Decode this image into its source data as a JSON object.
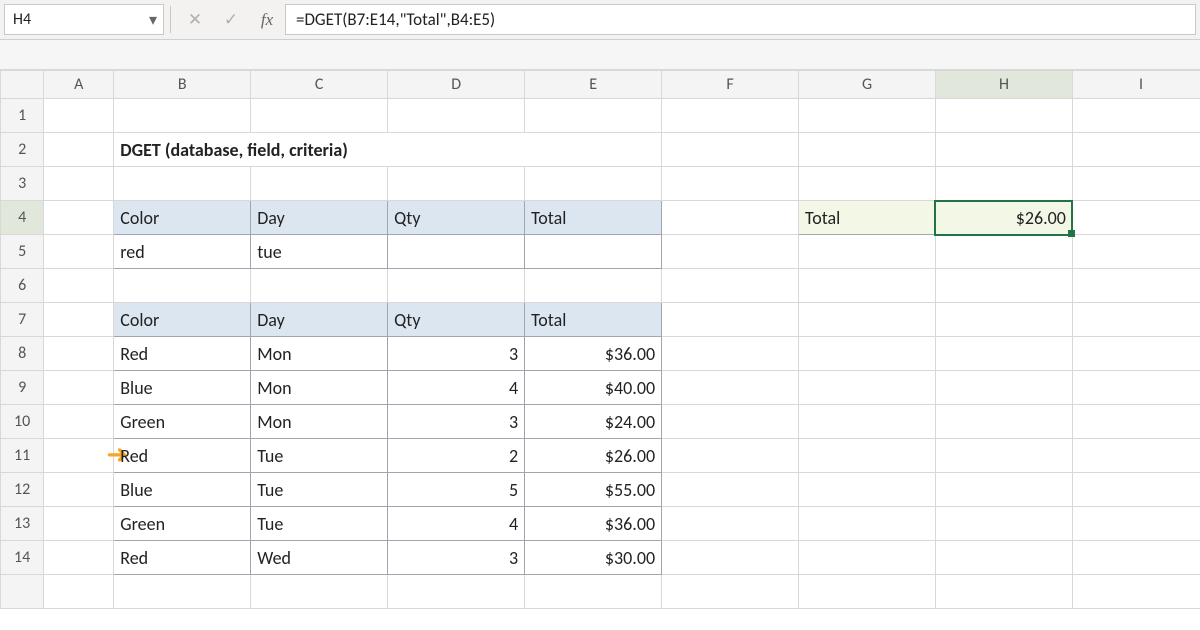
{
  "toolbar": {
    "namebox_value": "H4",
    "formula": "=DGET(B7:E14,\"Total\",B4:E5)",
    "fx_label": "fx",
    "cancel_glyph": "✕",
    "enter_glyph": "✓",
    "dropdown_glyph": "▾"
  },
  "columns": [
    "A",
    "B",
    "C",
    "D",
    "E",
    "F",
    "G",
    "H",
    "I"
  ],
  "row_count": 14,
  "active": {
    "col": "H",
    "row": 4
  },
  "title": {
    "text": "DGET (database, field, criteria)",
    "cell": "B2"
  },
  "criteria_table": {
    "headers": [
      "Color",
      "Day",
      "Qty",
      "Total"
    ],
    "rows": [
      [
        "red",
        "tue",
        "",
        ""
      ]
    ]
  },
  "data_table": {
    "headers": [
      "Color",
      "Day",
      "Qty",
      "Total"
    ],
    "rows": [
      {
        "color": "Red",
        "day": "Mon",
        "qty": "3",
        "total": "$36.00"
      },
      {
        "color": "Blue",
        "day": "Mon",
        "qty": "4",
        "total": "$40.00"
      },
      {
        "color": "Green",
        "day": "Mon",
        "qty": "3",
        "total": "$24.00"
      },
      {
        "color": "Red",
        "day": "Tue",
        "qty": "2",
        "total": "$26.00",
        "highlight": true
      },
      {
        "color": "Blue",
        "day": "Tue",
        "qty": "5",
        "total": "$55.00"
      },
      {
        "color": "Green",
        "day": "Tue",
        "qty": "4",
        "total": "$36.00"
      },
      {
        "color": "Red",
        "day": "Wed",
        "qty": "3",
        "total": "$30.00"
      }
    ]
  },
  "result": {
    "label": "Total",
    "value": "$26.00"
  },
  "annotation": {
    "arrow_row": 11,
    "arrow_glyph": "➜"
  }
}
